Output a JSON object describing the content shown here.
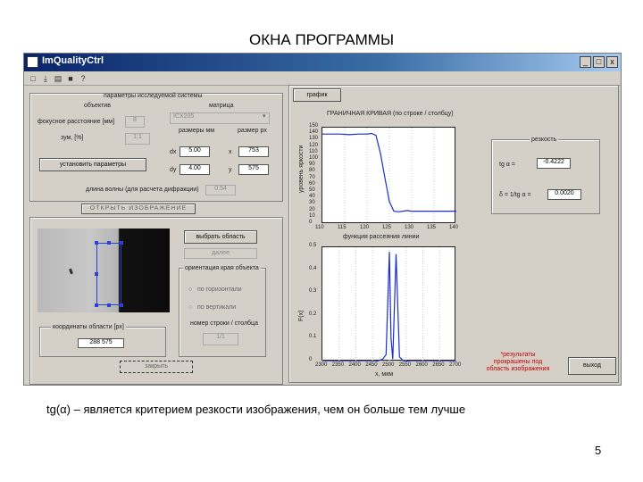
{
  "slide": {
    "title": "ОКНА ПРОГРАММЫ",
    "caption": "tg(α) – является критерием резкости изображения, чем он больше тем лучше",
    "page_number": "5"
  },
  "window": {
    "title": "ImQualityCtrl",
    "controls": [
      "_",
      "□",
      "x"
    ],
    "toolbar_icons": [
      "open-icon",
      "save-icon",
      "print-icon",
      "help-icon"
    ]
  },
  "params_panel": {
    "header": "параметры исследуемой системы",
    "object_label": "объектив",
    "matrix_label": "матрица",
    "focal_label": "фокусное расстояние [мм]",
    "focal_value": "8",
    "matrix_select": "ICX205",
    "zoom_label": "зум, [%]",
    "zoom_value": "1:1",
    "size_mm_label": "размеры мм",
    "size_px_label": "размер px",
    "dx_label": "dx",
    "dx_value": "5.00",
    "px_x_value": "753",
    "dy_label": "dy",
    "dy_value": "4.00",
    "px_y_value": "575",
    "apply_button": "установить параметры",
    "length_label": "длина волны (для расчета дифракции)",
    "length_value": "0.54"
  },
  "image_panel": {
    "open_button": "ОТКРЫТЬ ИЗОБРАЖЕНИЕ",
    "select_area_button": "выбрать область",
    "next_button": "далее",
    "orientation_header": "ориентация края объекта",
    "horizontal_option": "по горизонтали",
    "vertical_option": "по вертикали",
    "count_label": "номер строки / столбца",
    "count_value": "1/1",
    "coords_header": "координаты области [px]",
    "coords_value": "288 575",
    "dashed_button": "закрыть"
  },
  "graph_panel": {
    "tab_label": "график",
    "top_title": "ГРАНИЧНАЯ КРИВАЯ (по строке / столбцу)",
    "top_ylabel": "уровень яркости",
    "bottom_title": "функция рассеяния линии",
    "bottom_ylabel": "F(x)",
    "bottom_xlabel": "x, мкм",
    "result_header": "резкость",
    "tg_label": "tg α =",
    "tg_value": "-0.4222",
    "delta_label": "δ = 1/tg α =",
    "delta_value": "0.0020",
    "note": "*результаты прокрашены под область изображения",
    "exit_button": "выход"
  },
  "chart_data": [
    {
      "type": "line",
      "title": "ГРАНИЧНАЯ КРИВАЯ (по строке / столбцу)",
      "ylabel": "уровень яркости",
      "x_ticks": [
        "110",
        "115",
        "120",
        "125",
        "130",
        "135",
        "140"
      ],
      "y_ticks": [
        "0",
        "10",
        "20",
        "30",
        "40",
        "50",
        "60",
        "70",
        "80",
        "90",
        "100",
        "110",
        "120",
        "130",
        "140",
        "150"
      ],
      "xlim": [
        110,
        140
      ],
      "ylim": [
        0,
        150
      ],
      "series": [
        {
          "x": [
            110,
            112,
            114,
            116,
            118,
            120,
            121,
            122,
            123,
            124,
            125,
            126,
            127,
            128,
            129,
            130,
            132,
            135,
            140
          ],
          "y": [
            140,
            140,
            140,
            139,
            140,
            140,
            141,
            138,
            110,
            72,
            35,
            20,
            19,
            20,
            21,
            20,
            20,
            20,
            20
          ]
        }
      ]
    },
    {
      "type": "line",
      "title": "функция рассеяния линии",
      "ylabel": "F(x)",
      "xlabel": "x, мкм",
      "x_ticks": [
        "2300",
        "2350",
        "2400",
        "2450",
        "2500",
        "2550",
        "2600",
        "2650",
        "2700"
      ],
      "y_ticks": [
        "0",
        "0.1",
        "0.2",
        "0.3",
        "0.4",
        "0.5"
      ],
      "xlim": [
        2300,
        2700
      ],
      "ylim": [
        0,
        0.5
      ],
      "series": [
        {
          "x": [
            2300,
            2460,
            2480,
            2490,
            2500,
            2505,
            2510,
            2520,
            2530,
            2540,
            2560,
            2600,
            2700
          ],
          "y": [
            0.0,
            0.0,
            0.01,
            0.03,
            0.48,
            0.1,
            0.01,
            0.47,
            0.02,
            0.005,
            0.0,
            0.0,
            0.0
          ]
        }
      ]
    }
  ]
}
